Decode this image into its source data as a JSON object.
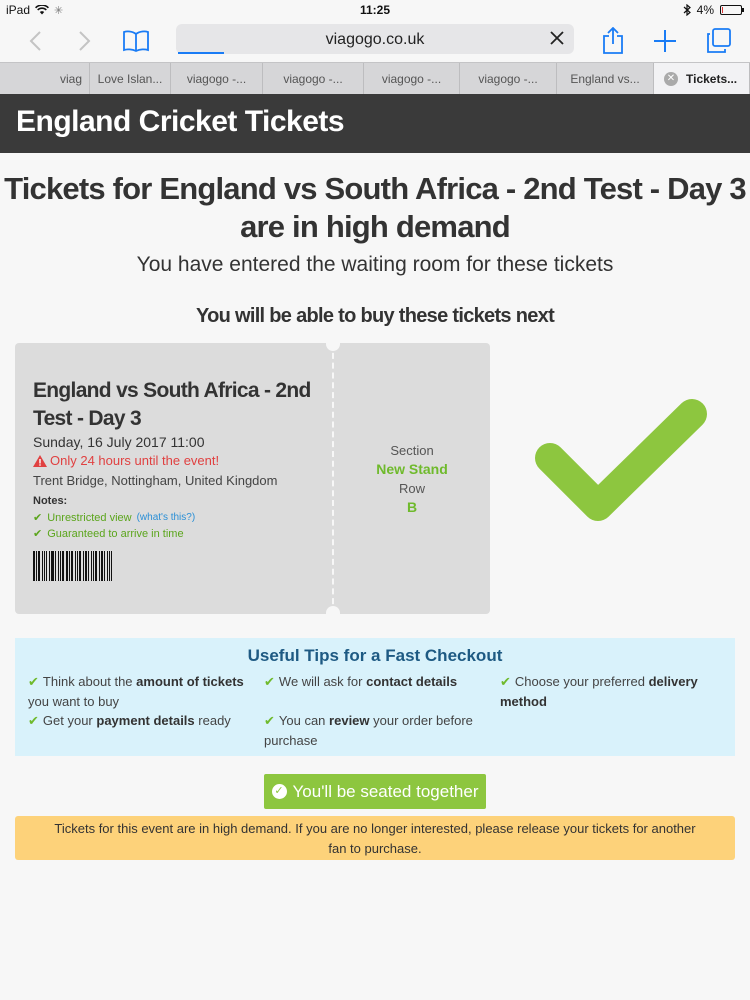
{
  "status": {
    "device": "iPad",
    "time": "11:25",
    "battery": "4%",
    "battery_level": 0.04
  },
  "browser": {
    "url": "viagogo.co.uk",
    "tabs": [
      "viag",
      "Love Islan...",
      "viagogo -...",
      "viagogo -...",
      "viagogo -...",
      "viagogo -...",
      "England vs...",
      "Tickets..."
    ]
  },
  "site": {
    "header_title": "England Cricket Tickets",
    "headline_1": "Tickets for England vs South Africa - 2nd Test - Day 3",
    "headline_2": "are in high demand",
    "subhead": "You have entered the waiting room for these tickets",
    "next_label": "You will be able to buy these tickets next"
  },
  "ticket": {
    "title": "England vs South Africa - 2nd Test - Day 3",
    "date": "Sunday, 16 July 2017 11:00",
    "warning": "Only 24 hours until the event!",
    "venue": "Trent Bridge, Nottingham, United Kingdom",
    "notes_label": "Notes:",
    "note_1": "Unrestricted view",
    "note_1_link": "(what's this?)",
    "note_2": "Guaranteed to arrive in time",
    "section_label": "Section",
    "section_value": "New Stand",
    "row_label": "Row",
    "row_value": "B"
  },
  "tips": {
    "title": "Useful Tips for a Fast Checkout",
    "t1_pre": "Think about the",
    "t1_bold": "amount of tickets",
    "t1_post": "you want to buy",
    "t2_pre": "We will ask for",
    "t2_bold": "contact details",
    "t3_pre": "Choose your preferred",
    "t3_bold": "delivery",
    "t3_bold2": "method",
    "t4_pre": "Get your",
    "t4_bold": "payment details",
    "t4_post": "ready",
    "t5_pre": "You can",
    "t5_bold": "review",
    "t5_post": "your order before",
    "t5_post2": "purchase"
  },
  "seated_button": "You'll be seated together",
  "demand_notice": "Tickets for this event are in high demand. If you are no longer interested, please release your tickets for another fan to purchase.",
  "colors": {
    "header_bg": "#3a3a3a",
    "accent_green": "#8dc63f",
    "warning_red": "#e04141",
    "tips_bg": "#d9f2fb",
    "notice_bg": "#fdd27a",
    "ios_blue": "#1a7cf5"
  },
  "icons": {
    "wifi": "wifi-icon",
    "bluetooth": "bluetooth-icon",
    "back": "back-chevron-icon",
    "forward": "forward-chevron-icon",
    "bookmarks": "book-icon",
    "share": "share-icon",
    "new_tab": "plus-icon",
    "tabs": "tabs-icon",
    "check": "check-icon",
    "warning": "warning-triangle-icon"
  }
}
